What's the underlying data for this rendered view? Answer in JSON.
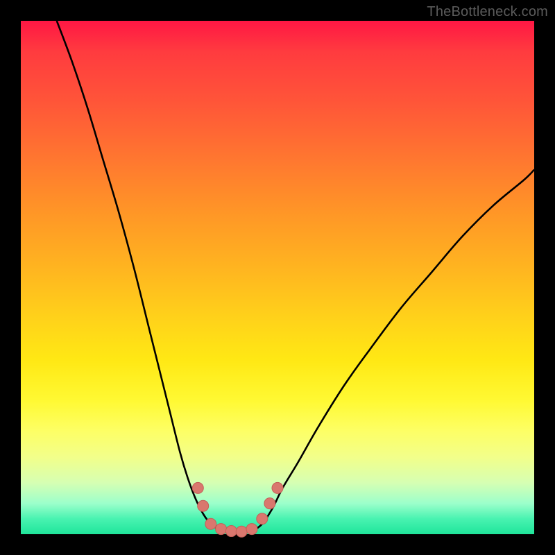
{
  "watermark": "TheBottleneck.com",
  "colors": {
    "frame_bg": "#000000",
    "gradient_top": "#ff1744",
    "gradient_mid": "#ffd21a",
    "gradient_bottom": "#1fe59b",
    "curve_stroke": "#000000",
    "marker_fill": "#d9776e",
    "marker_stroke": "#c45f57"
  },
  "chart_data": {
    "type": "line",
    "title": "",
    "xlabel": "",
    "ylabel": "",
    "xlim": [
      0,
      100
    ],
    "ylim": [
      0,
      100
    ],
    "series": [
      {
        "name": "left-curve",
        "x": [
          7,
          10,
          13,
          16,
          19,
          22,
          25,
          27,
          29,
          31,
          32.5,
          34,
          35.5,
          37,
          38.5,
          40
        ],
        "y": [
          100,
          92,
          83,
          73,
          63,
          52,
          40,
          32,
          24,
          16,
          11,
          7,
          4,
          2,
          1,
          0.5
        ]
      },
      {
        "name": "right-curve",
        "x": [
          45,
          47,
          49,
          51,
          54,
          58,
          63,
          68,
          74,
          80,
          86,
          92,
          98,
          100
        ],
        "y": [
          0.5,
          2,
          5,
          9,
          14,
          21,
          29,
          36,
          44,
          51,
          58,
          64,
          69,
          71
        ]
      }
    ],
    "markers": [
      {
        "x": 34.5,
        "y": 9.0
      },
      {
        "x": 35.5,
        "y": 5.5
      },
      {
        "x": 37.0,
        "y": 2.0
      },
      {
        "x": 39.0,
        "y": 1.0
      },
      {
        "x": 41.0,
        "y": 0.6
      },
      {
        "x": 43.0,
        "y": 0.5
      },
      {
        "x": 45.0,
        "y": 1.0
      },
      {
        "x": 47.0,
        "y": 3.0
      },
      {
        "x": 48.5,
        "y": 6.0
      },
      {
        "x": 50.0,
        "y": 9.0
      }
    ],
    "marker_radius_px": 8
  }
}
